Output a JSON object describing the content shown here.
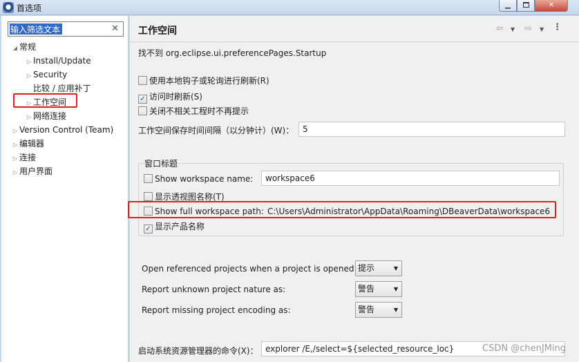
{
  "window": {
    "title": "首选项",
    "icon": "eclipse-app-icon"
  },
  "sidebar": {
    "filter_placeholder": "输入筛选文本",
    "filter_value": "输入筛选文本",
    "items": [
      {
        "label": "常规",
        "twisty": "expanded"
      },
      {
        "label": "Install/Update",
        "twisty": "collapsed"
      },
      {
        "label": "Security",
        "twisty": "collapsed"
      },
      {
        "label": "比较 / 应用补丁",
        "twisty": "none"
      },
      {
        "label": "工作空间",
        "twisty": "collapsed",
        "selected": true
      },
      {
        "label": "网络连接",
        "twisty": "collapsed"
      },
      {
        "label": "Version Control (Team)",
        "twisty": "collapsed"
      },
      {
        "label": "编辑器",
        "twisty": "collapsed"
      },
      {
        "label": "连接",
        "twisty": "collapsed"
      },
      {
        "label": "用户界面",
        "twisty": "collapsed"
      }
    ]
  },
  "main": {
    "title": "工作空间",
    "message": "找不到 org.eclipse.ui.preferencePages.Startup",
    "options": {
      "native_hooks": "使用本地钩子或轮询进行刷新(R)",
      "refresh_on_access": "访问时刷新(S)",
      "close_unrelated": "关闭不相关工程时不再提示"
    },
    "save_interval_label": "工作空间保存时间间隔（以分钟计）(W)：",
    "save_interval_value": "5",
    "window_title_group": {
      "title": "窗口标题",
      "show_workspace_name": "Show workspace name:",
      "workspace_name_value": "workspace6",
      "show_perspective_name": "显示透视图名称(T)",
      "show_full_path": "Show full workspace path:",
      "full_path_value": "C:\\Users\\Administrator\\AppData\\Roaming\\DBeaverData\\workspace6",
      "show_product_name": "显示产品名称"
    },
    "open_referenced_label": "Open referenced projects when a project is opened:",
    "open_referenced_value": "提示",
    "unknown_nature_label": "Report unknown project nature as:",
    "unknown_nature_value": "警告",
    "missing_encoding_label": "Report missing project encoding as:",
    "missing_encoding_value": "警告",
    "explorer_command_label": "启动系统资源管理器的命令(X)：",
    "explorer_command_value": "explorer /E,/select=${selected_resource_loc}"
  },
  "watermark": "CSDN @chenJMing",
  "colors": {
    "highlight_red": "#e01e1e",
    "selection_blue": "#3169c6"
  }
}
